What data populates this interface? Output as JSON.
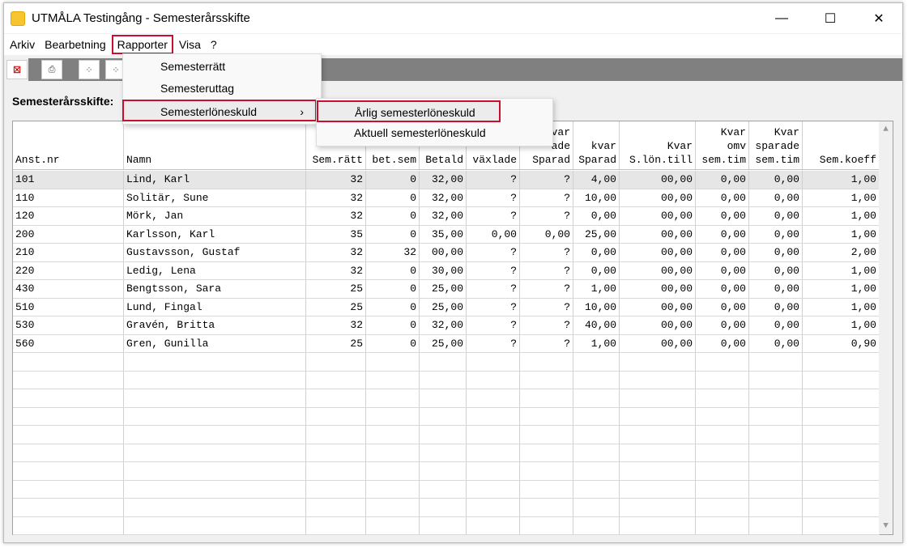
{
  "window": {
    "title": "UTMÅLA Testingång - Semesterårsskifte",
    "minimize": "—",
    "maximize": "☐",
    "close": "✕"
  },
  "menubar": [
    "Arkiv",
    "Bearbetning",
    "Rapporter",
    "Visa",
    "?"
  ],
  "rapporter_menu": {
    "items": [
      "Semesterrätt",
      "Semesteruttag",
      "Semesterlöneskuld"
    ],
    "arrow": "›"
  },
  "submenu": {
    "items": [
      "Årlig semesterlöneskuld",
      "Aktuell semesterlöneskuld"
    ]
  },
  "toolbar": {
    "icons": [
      "close-record-icon",
      "print-icon",
      "grid-icon",
      "grid2-icon"
    ]
  },
  "section_label": "Semesterårsskifte:",
  "columns": [
    {
      "lines": [
        "Anst.nr"
      ]
    },
    {
      "lines": [
        "Namn"
      ]
    },
    {
      "lines": [
        "Sem.rätt"
      ]
    },
    {
      "lines": [
        "bet.sem"
      ]
    },
    {
      "lines": [
        "Betald"
      ]
    },
    {
      "lines": [
        "växlade"
      ]
    },
    {
      "lines": [
        "var",
        "ade",
        "Sparad"
      ]
    },
    {
      "lines": [
        "kvar",
        "Sparad"
      ]
    },
    {
      "lines": [
        "Kvar",
        "S.lön.till"
      ]
    },
    {
      "lines": [
        "Kvar",
        "omv",
        "sem.tim"
      ]
    },
    {
      "lines": [
        "Kvar",
        "sparade",
        "sem.tim"
      ]
    },
    {
      "lines": [
        "Sem.koeff"
      ]
    }
  ],
  "rows": [
    [
      "101",
      "Lind, Karl",
      "32",
      "0",
      "32,00",
      "?",
      "?",
      "4,00",
      "00,00",
      "0,00",
      "0,00",
      "1,00"
    ],
    [
      "110",
      "Solitär, Sune",
      "32",
      "0",
      "32,00",
      "?",
      "?",
      "10,00",
      "00,00",
      "0,00",
      "0,00",
      "1,00"
    ],
    [
      "120",
      "Mörk, Jan",
      "32",
      "0",
      "32,00",
      "?",
      "?",
      "0,00",
      "00,00",
      "0,00",
      "0,00",
      "1,00"
    ],
    [
      "200",
      "Karlsson, Karl",
      "35",
      "0",
      "35,00",
      "0,00",
      "0,00",
      "25,00",
      "00,00",
      "0,00",
      "0,00",
      "1,00"
    ],
    [
      "210",
      "Gustavsson, Gustaf",
      "32",
      "32",
      "00,00",
      "?",
      "?",
      "0,00",
      "00,00",
      "0,00",
      "0,00",
      "2,00"
    ],
    [
      "220",
      "Ledig, Lena",
      "32",
      "0",
      "30,00",
      "?",
      "?",
      "0,00",
      "00,00",
      "0,00",
      "0,00",
      "1,00"
    ],
    [
      "430",
      "Bengtsson, Sara",
      "25",
      "0",
      "25,00",
      "?",
      "?",
      "1,00",
      "00,00",
      "0,00",
      "0,00",
      "1,00"
    ],
    [
      "510",
      "Lund, Fingal",
      "25",
      "0",
      "25,00",
      "?",
      "?",
      "10,00",
      "00,00",
      "0,00",
      "0,00",
      "1,00"
    ],
    [
      "530",
      "Gravén, Britta",
      "32",
      "0",
      "32,00",
      "?",
      "?",
      "40,00",
      "00,00",
      "0,00",
      "0,00",
      "1,00"
    ],
    [
      "560",
      "Gren, Gunilla",
      "25",
      "0",
      "25,00",
      "?",
      "?",
      "1,00",
      "00,00",
      "0,00",
      "0,00",
      "0,90"
    ]
  ],
  "scroll": {
    "up": "▲",
    "down": "▼"
  }
}
